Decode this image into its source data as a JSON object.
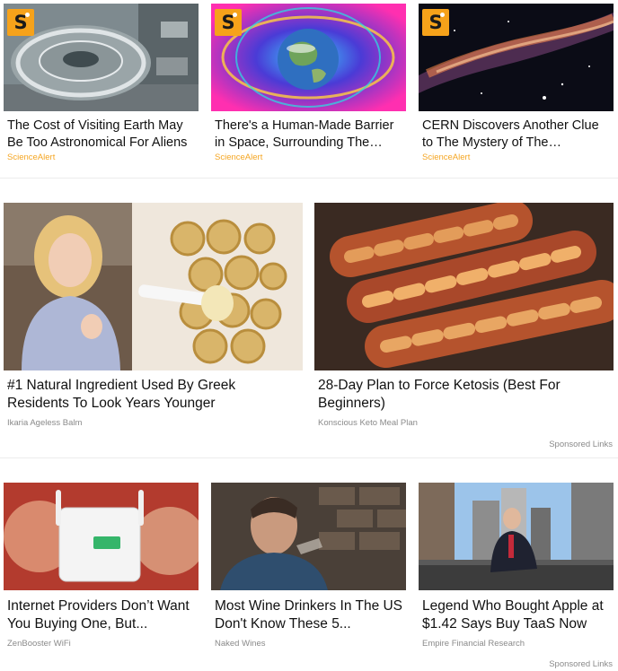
{
  "row1": [
    {
      "title": "The Cost of Visiting Earth May Be Too Astronomical For Aliens",
      "source": "ScienceAlert",
      "badge": "S"
    },
    {
      "title": "There's a Human-Made Barrier in Space, Surrounding The Enti...",
      "source": "ScienceAlert",
      "badge": "S"
    },
    {
      "title": "CERN Discovers Another Clue to The Mystery of The Universe's...",
      "source": "ScienceAlert",
      "badge": "S"
    }
  ],
  "row2": [
    {
      "title": "#1 Natural Ingredient Used By Greek Residents To Look Years Younger",
      "source": "Ikaria Ageless Balm"
    },
    {
      "title": "28-Day Plan to Force Ketosis (Best For Beginners)",
      "source": "Konscious Keto Meal Plan"
    }
  ],
  "row2_sponsored": "Sponsored Links",
  "row3": [
    {
      "title": "Internet Providers Don’t Want You Buying One, But...",
      "source": "ZenBooster WiFi"
    },
    {
      "title": "Most Wine Drinkers In The US Don't Know These 5...",
      "source": "Naked Wines"
    },
    {
      "title": "Legend Who Bought Apple at $1.42 Says Buy TaaS Now",
      "source": "Empire Financial Research"
    }
  ],
  "row3_sponsored": "Sponsored Links",
  "colors": {
    "brand": "#f6a21a",
    "source_orange": "#f5a623",
    "source_grey": "#8a8a8a"
  }
}
